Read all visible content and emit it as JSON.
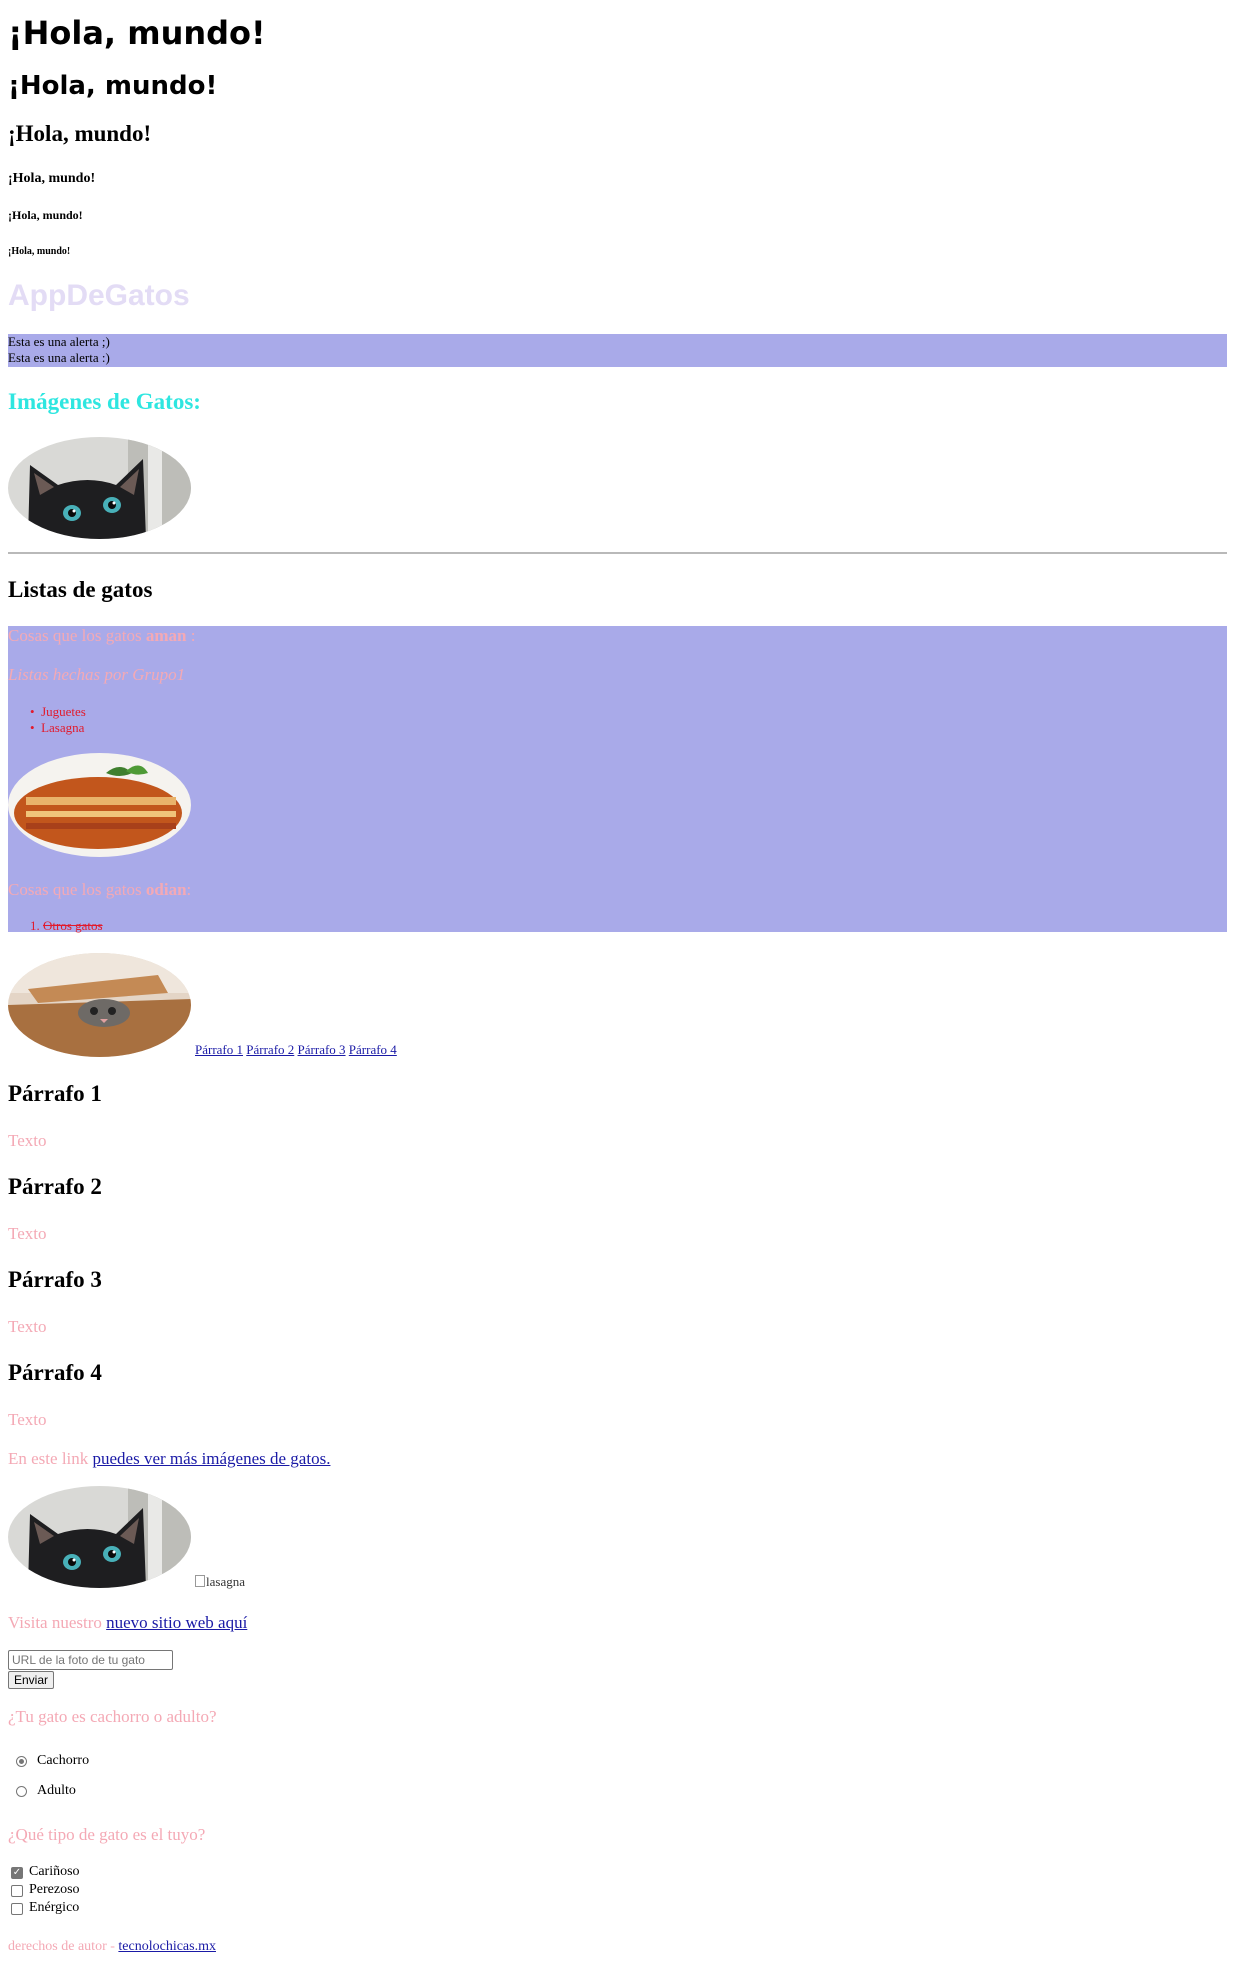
{
  "headings": {
    "h1": "¡Hola, mundo!",
    "h2": "¡Hola, mundo!",
    "h3": "¡Hola, mundo!",
    "h4": "¡Hola, mundo!",
    "h5": "¡Hola, mundo!",
    "h6": "¡Hola, mundo!"
  },
  "brand": "AppDeGatos",
  "alerts": [
    "Esta es una alerta ;)",
    "Esta es una alerta :)"
  ],
  "images_title": "Imágenes de Gatos:",
  "lists_title": "Listas de gatos",
  "loves": {
    "prefix": "Cosas que los gatos ",
    "strong": "aman",
    "suffix": " :",
    "credit": "Listas hechas por Grupo1",
    "items": [
      "Juguetes",
      "Lasagna"
    ]
  },
  "hates": {
    "prefix": "Cosas que los gatos ",
    "strong": "odian",
    "suffix": ":",
    "items": [
      "Otros gatos"
    ]
  },
  "nav_links": [
    "Párrafo 1",
    "Párrafo 2",
    "Párrafo 3",
    "Párrafo 4"
  ],
  "sections": [
    {
      "title": "Párrafo 1",
      "text": "Texto"
    },
    {
      "title": "Párrafo 2",
      "text": "Texto"
    },
    {
      "title": "Párrafo 3",
      "text": "Texto"
    },
    {
      "title": "Párrafo 4",
      "text": "Texto"
    }
  ],
  "more_images": {
    "prefix": "En este link ",
    "link": "puedes ver más imágenes de gatos."
  },
  "broken_image_alt": "lasagna",
  "visit": {
    "prefix": "Visita nuestro ",
    "link": "nuevo sitio web aquí"
  },
  "form": {
    "url_placeholder": "URL de la foto de tu gato",
    "submit": "Enviar",
    "age_question": "¿Tu gato es cachorro o adulto?",
    "age_options": [
      "Cachorro",
      "Adulto"
    ],
    "age_selected": "Cachorro",
    "type_question": "¿Qué tipo de gato es el tuyo?",
    "type_options": [
      "Cariñoso",
      "Perezoso",
      "Enérgico"
    ],
    "type_checked": [
      "Cariñoso"
    ]
  },
  "footer": {
    "prefix": "derechos de autor - ",
    "link": "tecnolochicas.mx"
  },
  "colors": {
    "alert_bg": "#a9aae9",
    "pink_text": "#f4a9b5",
    "cyan_title": "#2ee6e0",
    "link": "#1a1aa6",
    "brand": "#e3dcf5"
  },
  "images": [
    "black-cat-photo",
    "lasagna-photo",
    "cat-in-box-photo",
    "black-cat-photo"
  ]
}
